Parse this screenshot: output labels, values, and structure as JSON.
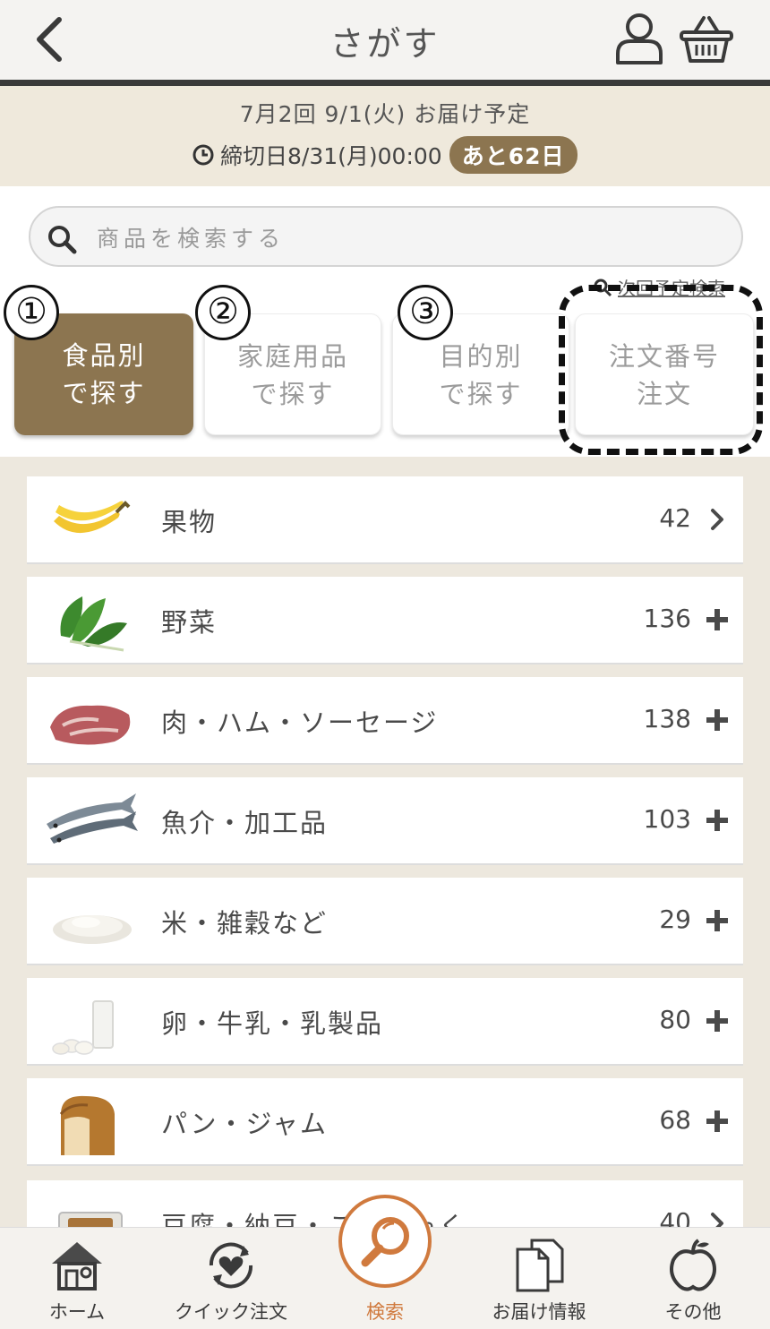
{
  "header": {
    "title": "さがす"
  },
  "delivery": {
    "schedule": "7月2回 9/1(火) お届け予定",
    "deadline": "締切日8/31(月)00:00",
    "remaining": "あと62日"
  },
  "search": {
    "placeholder": "商品を検索する",
    "next_search": "次回予定検索"
  },
  "markers": [
    "①",
    "②",
    "③"
  ],
  "tabs": [
    {
      "line1": "食品別",
      "line2": "で探す"
    },
    {
      "line1": "家庭用品",
      "line2": "で探す"
    },
    {
      "line1": "目的別",
      "line2": "で探す"
    },
    {
      "line1": "注文番号",
      "line2": "注文"
    }
  ],
  "categories": [
    {
      "label": "果物",
      "count": "42",
      "indicator": "chevron-right-icon",
      "thumb": "banana-icon"
    },
    {
      "label": "野菜",
      "count": "136",
      "indicator": "plus-icon",
      "thumb": "spinach-icon"
    },
    {
      "label": "肉・ハム・ソーセージ",
      "count": "138",
      "indicator": "plus-icon",
      "thumb": "meat-icon"
    },
    {
      "label": "魚介・加工品",
      "count": "103",
      "indicator": "plus-icon",
      "thumb": "fish-icon"
    },
    {
      "label": "米・雑穀など",
      "count": "29",
      "indicator": "plus-icon",
      "thumb": "rice-icon"
    },
    {
      "label": "卵・牛乳・乳製品",
      "count": "80",
      "indicator": "plus-icon",
      "thumb": "egg-milk-icon"
    },
    {
      "label": "パン・ジャム",
      "count": "68",
      "indicator": "plus-icon",
      "thumb": "bread-icon"
    },
    {
      "label": "豆腐・納豆・こんにゃく",
      "count": "40",
      "indicator": "chevron-right-icon",
      "thumb": "natto-icon"
    }
  ],
  "nav": [
    {
      "label": "ホーム",
      "icon": "home-icon"
    },
    {
      "label": "クイック注文",
      "icon": "heart-refresh-icon"
    },
    {
      "label": "検索",
      "icon": "search-icon"
    },
    {
      "label": "お届け情報",
      "icon": "documents-icon"
    },
    {
      "label": "その他",
      "icon": "apple-icon"
    }
  ],
  "colors": {
    "accent": "#8c7550",
    "nav_active": "#d07a3e",
    "header_bg": "#f4f3f1",
    "notice_bg": "#efe9dc"
  }
}
